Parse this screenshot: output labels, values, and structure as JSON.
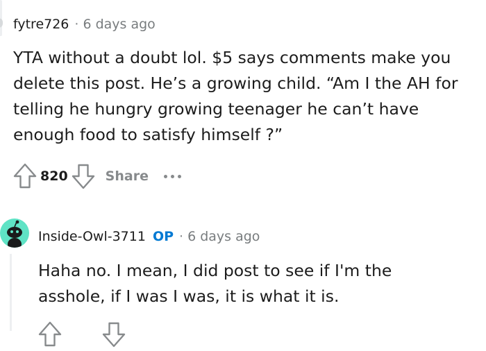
{
  "comment": {
    "author": "fytre726",
    "separator": "·",
    "time": "6 days ago",
    "lines": [
      "YTA without a doubt lol. $5 says comments make you",
      "delete this post. He’s a growing child. “Am I the AH for",
      "telling he hungry growing teenager he can’t have",
      "enough food to satisfy himself ?”"
    ],
    "score": "820",
    "share_label": "Share"
  },
  "reply": {
    "author": "Inside-Owl-3711",
    "op_badge": "OP",
    "separator": "·",
    "time": "6 days ago",
    "lines": [
      "Haha no. I mean, I did post to see if I'm the",
      "asshole, if I was I was, it is what it is."
    ]
  },
  "colors": {
    "op_blue": "#0079d3",
    "avatar_bg": "#5fe3c5",
    "muted": "#878a8c"
  },
  "icons": [
    "upvote-icon",
    "downvote-icon",
    "more-options-icon",
    "avatar-snoo-icon"
  ]
}
